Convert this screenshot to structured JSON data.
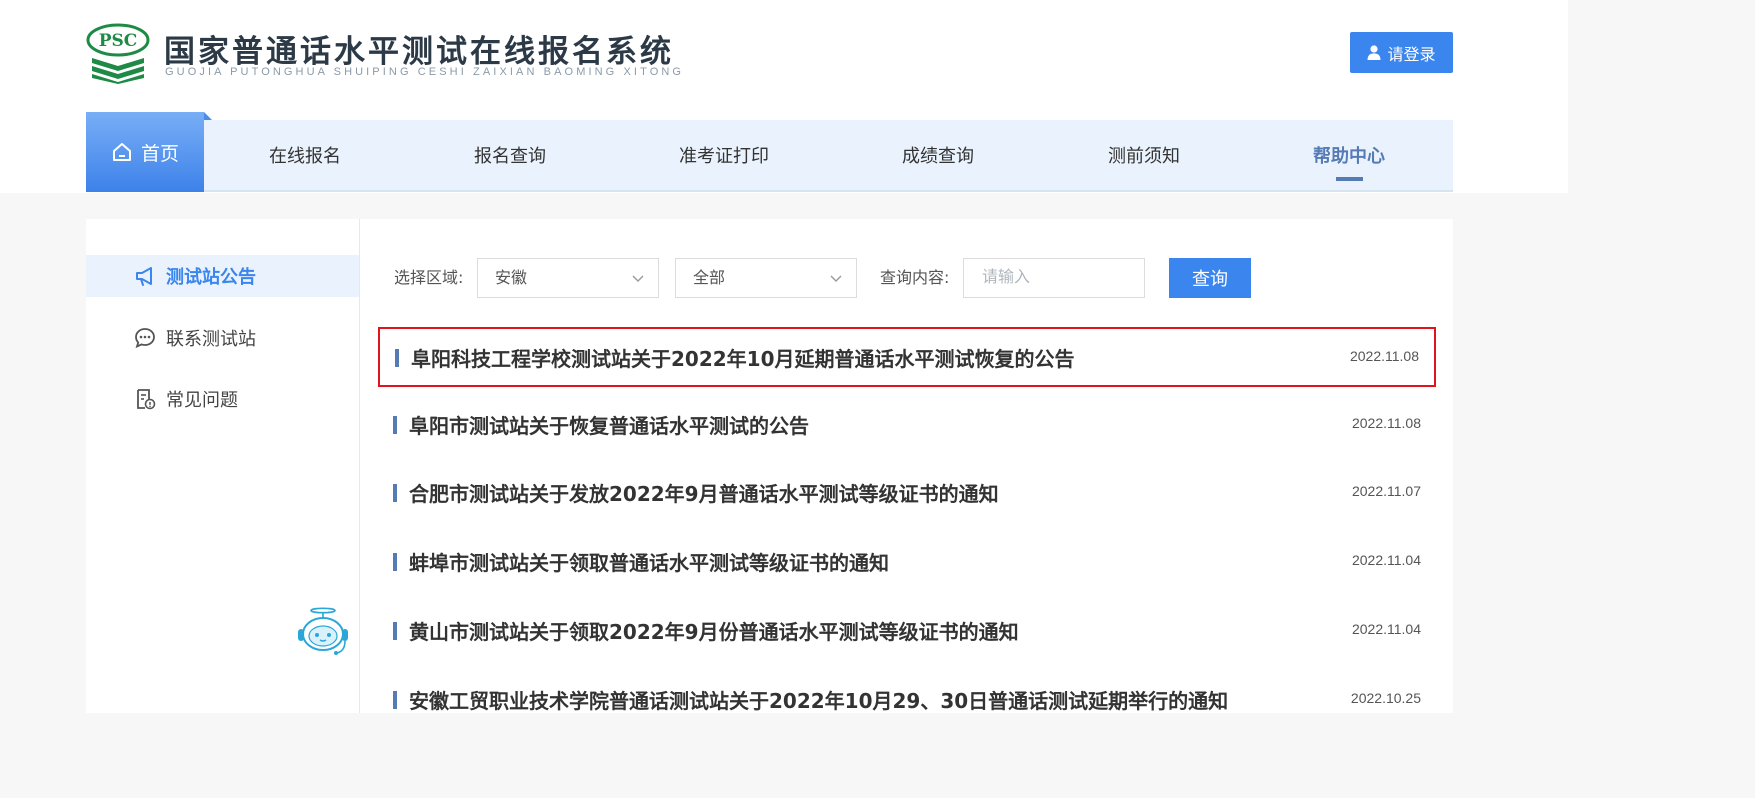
{
  "header": {
    "logo_badge": "PSC",
    "title": "国家普通话水平测试在线报名系统",
    "subtitle": "GUOJIA PUTONGHUA SHUIPING CESHI ZAIXIAN BAOMING XITONG",
    "login_label": "请登录",
    "login_icon": "user-icon"
  },
  "nav": {
    "home": {
      "label": "首页",
      "icon": "home-icon"
    },
    "items": [
      {
        "label": "在线报名"
      },
      {
        "label": "报名查询"
      },
      {
        "label": "准考证打印"
      },
      {
        "label": "成绩查询"
      },
      {
        "label": "测前须知"
      },
      {
        "label": "帮助中心",
        "active": true
      }
    ]
  },
  "sidebar": {
    "items": [
      {
        "label": "测试站公告",
        "icon": "megaphone-icon",
        "active": true
      },
      {
        "label": "联系测试站",
        "icon": "chat-icon"
      },
      {
        "label": "常见问题",
        "icon": "faq-document-icon"
      }
    ],
    "assistant_icon": "robot-assistant-icon"
  },
  "filters": {
    "region_label": "选择区域:",
    "region_value": "安徽",
    "category_value": "全部",
    "query_label": "查询内容:",
    "query_placeholder": "请输入",
    "query_value": "",
    "search_button": "查询"
  },
  "news": [
    {
      "title": "阜阳科技工程学校测试站关于2022年10月延期普通话水平测试恢复的公告",
      "date": "2022.11.08",
      "highlighted": true
    },
    {
      "title": "阜阳市测试站关于恢复普通话水平测试的公告",
      "date": "2022.11.08"
    },
    {
      "title": "合肥市测试站关于发放2022年9月普通话水平测试等级证书的通知",
      "date": "2022.11.07"
    },
    {
      "title": "蚌埠市测试站关于领取普通话水平测试等级证书的通知",
      "date": "2022.11.04"
    },
    {
      "title": "黄山市测试站关于领取2022年9月份普通话水平测试等级证书的通知",
      "date": "2022.11.04"
    },
    {
      "title": "安徽工贸职业技术学院普通话测试站关于2022年10月29、30日普通话测试延期举行的通知",
      "date": "2022.10.25"
    }
  ],
  "colors": {
    "accent": "#3a86ee",
    "nav_active": "#557bb5",
    "highlight_border": "#e2141b"
  }
}
